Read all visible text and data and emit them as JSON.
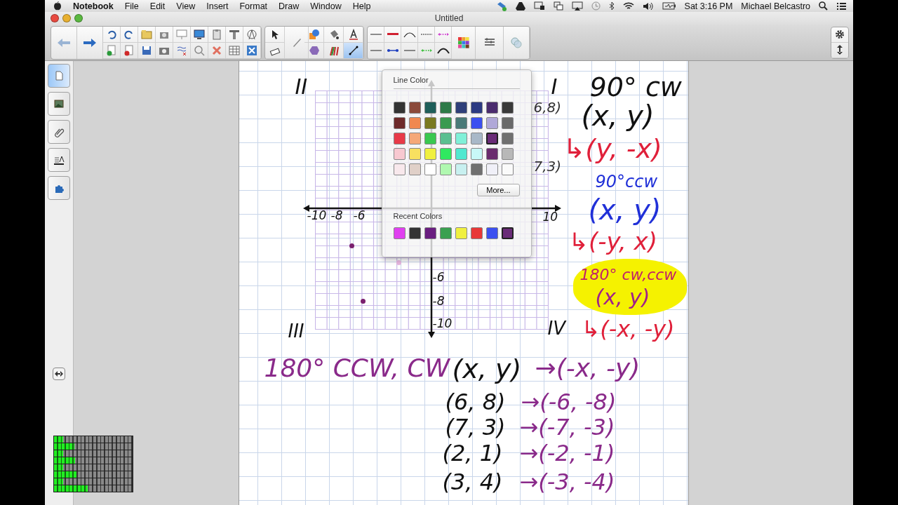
{
  "menu_bar": {
    "app": "Notebook",
    "items": [
      "File",
      "Edit",
      "View",
      "Insert",
      "Format",
      "Draw",
      "Window",
      "Help"
    ],
    "clock": "Sat 3:16 PM",
    "user": "Michael Belcastro"
  },
  "window": {
    "title": "Untitled"
  },
  "tools": [
    {
      "kind": "select",
      "selected": false
    },
    {
      "kind": "eraser",
      "selected": false
    },
    {
      "kind": "pen",
      "selected": false
    },
    {
      "kind": "shapes",
      "selected": false
    },
    {
      "kind": "polygon",
      "selected": false
    },
    {
      "kind": "fill",
      "selected": false
    },
    {
      "kind": "pens",
      "selected": false
    },
    {
      "kind": "text",
      "selected": false
    },
    {
      "kind": "line",
      "selected": true
    }
  ],
  "side_tabs": [
    {
      "kind": "pages",
      "selected": true
    },
    {
      "kind": "gallery",
      "selected": false
    },
    {
      "kind": "attachments",
      "selected": false
    },
    {
      "kind": "properties",
      "selected": false
    },
    {
      "kind": "addons",
      "selected": false
    }
  ],
  "ink": [
    {
      "text": "II",
      "color": "#111111"
    },
    {
      "text": "I",
      "color": "#111111"
    },
    {
      "text": "III",
      "color": "#111111"
    },
    {
      "text": "IV",
      "color": "#111111"
    },
    {
      "text": "-10",
      "color": "#111111"
    },
    {
      "text": "-8",
      "color": "#111111"
    },
    {
      "text": "-6",
      "color": "#111111"
    },
    {
      "text": "10",
      "color": "#111111"
    },
    {
      "text": "-6",
      "color": "#111111"
    },
    {
      "text": "-8",
      "color": "#111111"
    },
    {
      "text": "-10",
      "color": "#111111"
    },
    {
      "text": "6,8)",
      "color": "#333333"
    },
    {
      "text": "7,3)",
      "color": "#333333"
    },
    {
      "text": "90° cw",
      "color": "#111111"
    },
    {
      "text": "(x, y)",
      "color": "#111111"
    },
    {
      "text": "↳(y, -x)",
      "color": "#e0203a"
    },
    {
      "text": "90°ccw",
      "color": "#2030d8"
    },
    {
      "text": "(x, y)",
      "color": "#2030d8"
    },
    {
      "text": "↳(-y, x)",
      "color": "#e0203a"
    },
    {
      "text": "180° cw,ccw",
      "color": "#c0206a"
    },
    {
      "text": "(x, y)",
      "color": "#a0208a"
    },
    {
      "text": "↳(-x, -y)",
      "color": "#e0203a"
    },
    {
      "text": "180° CCW, CW",
      "color": "#8a2a8a"
    },
    {
      "text": "(x, y)",
      "color": "#111111"
    },
    {
      "text": "→(-x, -y)",
      "color": "#8a2a8a"
    },
    {
      "text": "(6, 8)",
      "color": "#111111"
    },
    {
      "text": "→(-6, -8)",
      "color": "#8a2a8a"
    },
    {
      "text": "(7, 3)",
      "color": "#111111"
    },
    {
      "text": "→(-7, -3)",
      "color": "#8a2a8a"
    },
    {
      "text": "(2, 1)",
      "color": "#111111"
    },
    {
      "text": "→(-2, -1)",
      "color": "#8a2a8a"
    },
    {
      "text": "(3, 4)",
      "color": "#111111"
    },
    {
      "text": "→(-3, -4)",
      "color": "#8a2a8a"
    }
  ],
  "points": [
    {
      "color": "#7a1f6e"
    },
    {
      "color": "#7a1f6e"
    },
    {
      "color": "#e8b7e0"
    }
  ],
  "highlights": [
    {
      "color": "#f5f200"
    }
  ],
  "color_popup": {
    "title": "Line Color",
    "more_button": "More...",
    "recent_title": "Recent Colors",
    "swatches": [
      {
        "color": "#333333",
        "selected": false
      },
      {
        "color": "#8b4a3a",
        "selected": false
      },
      {
        "color": "#1f5f5a",
        "selected": false
      },
      {
        "color": "#2e7a48",
        "selected": false
      },
      {
        "color": "#2f3f7a",
        "selected": false
      },
      {
        "color": "#2c3a82",
        "selected": false
      },
      {
        "color": "#4b2c6e",
        "selected": false
      },
      {
        "color": "#3a3a3a",
        "selected": false
      },
      {
        "color": "#6e2a2a",
        "selected": false
      },
      {
        "color": "#f08850",
        "selected": false
      },
      {
        "color": "#7a7a20",
        "selected": false
      },
      {
        "color": "#3a9a50",
        "selected": false
      },
      {
        "color": "#4a7a78",
        "selected": false
      },
      {
        "color": "#3c50f0",
        "selected": false
      },
      {
        "color": "#b0a8d8",
        "selected": false
      },
      {
        "color": "#6a6a6a",
        "selected": false
      },
      {
        "color": "#e83a48",
        "selected": false
      },
      {
        "color": "#f5a878",
        "selected": false
      },
      {
        "color": "#3ac850",
        "selected": false
      },
      {
        "color": "#5abf90",
        "selected": false
      },
      {
        "color": "#80f0d8",
        "selected": false
      },
      {
        "color": "#a8b8c8",
        "selected": false
      },
      {
        "color": "#6a2c78",
        "selected": true
      },
      {
        "color": "#707070",
        "selected": false
      },
      {
        "color": "#f8c8d0",
        "selected": false
      },
      {
        "color": "#f8e060",
        "selected": false
      },
      {
        "color": "#f0f040",
        "selected": false
      },
      {
        "color": "#30e860",
        "selected": false
      },
      {
        "color": "#50e8d0",
        "selected": false
      },
      {
        "color": "#c8f8f8",
        "selected": false
      },
      {
        "color": "#6a2c6e",
        "selected": false
      },
      {
        "color": "#b8b8b8",
        "selected": false
      },
      {
        "color": "#f8e8ec",
        "selected": false
      },
      {
        "color": "#e0d0c8",
        "selected": false
      },
      {
        "color": "#ffffff",
        "selected": false
      },
      {
        "color": "#b0f8b0",
        "selected": false
      },
      {
        "color": "#c8f0f0",
        "selected": false
      },
      {
        "color": "#707070",
        "selected": false
      },
      {
        "color": "#f0f0f8",
        "selected": false
      },
      {
        "color": "#fafafa",
        "selected": false
      }
    ],
    "recent": [
      {
        "color": "#e040f0",
        "selected": false
      },
      {
        "color": "#333333",
        "selected": false
      },
      {
        "color": "#6a1e80",
        "selected": false
      },
      {
        "color": "#3aa050",
        "selected": false
      },
      {
        "color": "#f0f040",
        "selected": false
      },
      {
        "color": "#e83838",
        "selected": false
      },
      {
        "color": "#3c50f0",
        "selected": false
      },
      {
        "color": "#6a2c78",
        "selected": true
      }
    ]
  },
  "meters": [
    {
      "level": 0.12
    },
    {
      "level": 0.26
    },
    {
      "level": 0.12
    },
    {
      "level": 0.27
    },
    {
      "level": 0.12
    },
    {
      "level": 0.29
    },
    {
      "level": 0.12
    },
    {
      "level": 0.43
    }
  ]
}
